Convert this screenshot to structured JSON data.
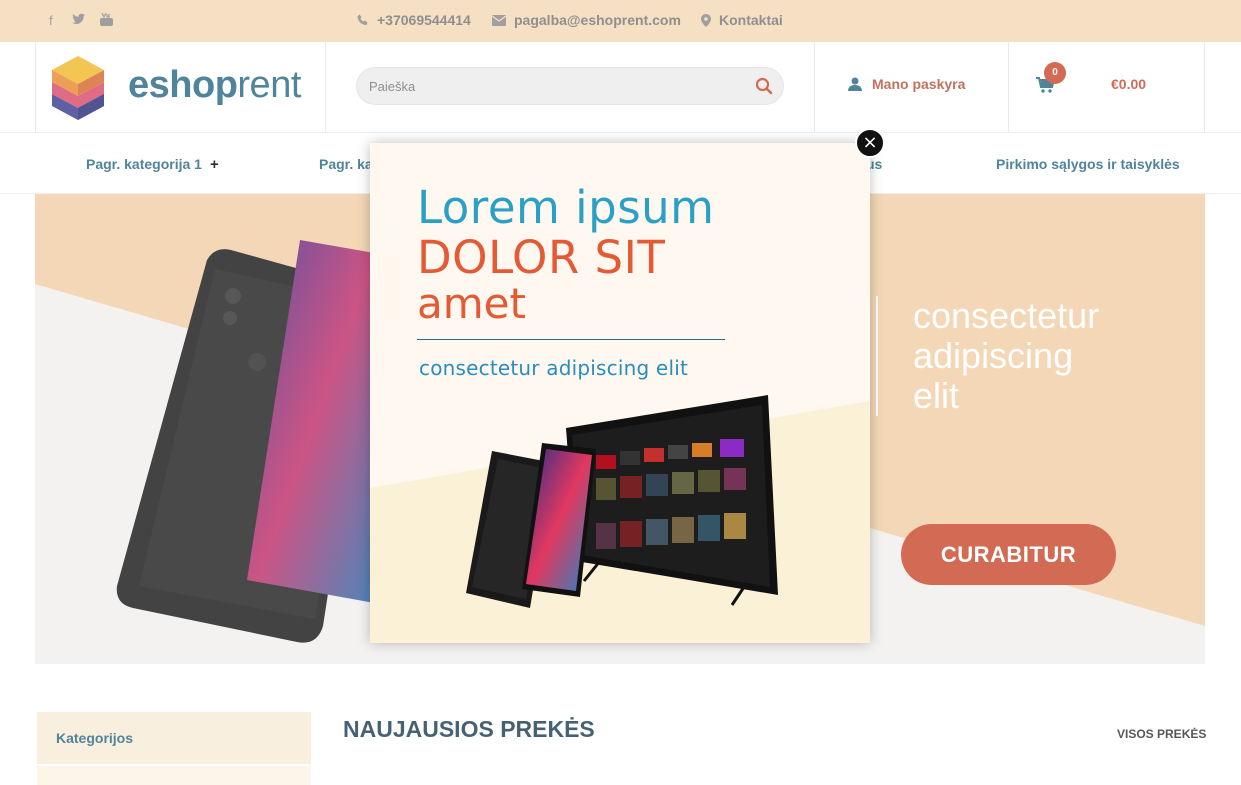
{
  "topbar": {
    "phone": "+37069544414",
    "email": "pagalba@eshoprent.com",
    "contacts": "Kontaktai"
  },
  "header": {
    "logo_bold": "eshop",
    "logo_light": "rent",
    "search_placeholder": "Paieška",
    "account": "Mano paskyra",
    "cart_count": "0",
    "cart_total": "€0.00"
  },
  "nav": {
    "items": [
      {
        "label": "Pagr. kategorija 1"
      },
      {
        "label": "Pagr. ka"
      },
      {
        "label": "us"
      },
      {
        "label": "Pirkimo sąlygos ir taisyklės"
      }
    ]
  },
  "hero": {
    "text_line1": "consectetur",
    "text_line2": "adipiscing",
    "text_line3": "elit",
    "button": "CURABITUR"
  },
  "popup": {
    "line1": "Lorem ipsum",
    "line2": "DOLOR SIT",
    "line3": "amet",
    "subtitle": "consectetur adipiscing elit",
    "close": "×"
  },
  "sidebar": {
    "title": "Kategorijos"
  },
  "products": {
    "heading": "NAUJAUSIOS PREKĖS",
    "all_link": "VISOS PREKĖS"
  },
  "colors": {
    "topbar": "#f3d9b7",
    "brand_blue": "#2a6a86",
    "accent_orange": "#c94a2f",
    "hero_peach": "#f1cfa6"
  }
}
